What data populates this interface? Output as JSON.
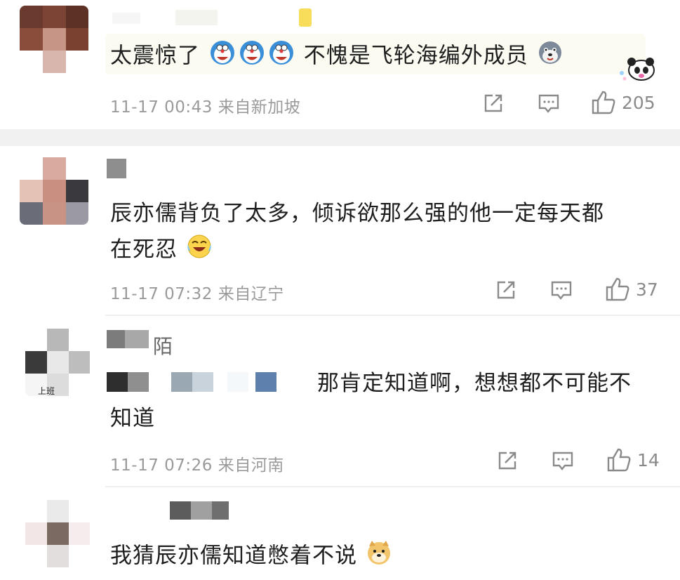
{
  "comments": [
    {
      "text": "太震惊了",
      "text_after": "不愧是飞轮海编外成员",
      "time": "11-17 00:43",
      "location": "来自新加坡",
      "likes": "205"
    },
    {
      "text_line1": "辰亦儒背负了太多，倾诉欲那么强的他一定每天都",
      "text_line2": "在死忍",
      "time": "11-17 07:32",
      "location": "来自辽宁",
      "likes": "37"
    },
    {
      "name_suffix": "陌",
      "avatar_caption": "上班",
      "text_line1": "那肯定知道啊，想想都不可能不",
      "text_line2": "知道",
      "time": "11-17 07:26",
      "location": "来自河南",
      "likes": "14"
    },
    {
      "text": "我猜辰亦儒知道憋着不说"
    }
  ],
  "icons": {
    "share": "share-icon",
    "comment": "comment-icon",
    "like": "thumbs-up-icon"
  },
  "colors": {
    "meta_text": "#9a9a9a",
    "divider": "#eeeeee",
    "section_gap": "#f1f1f1"
  }
}
